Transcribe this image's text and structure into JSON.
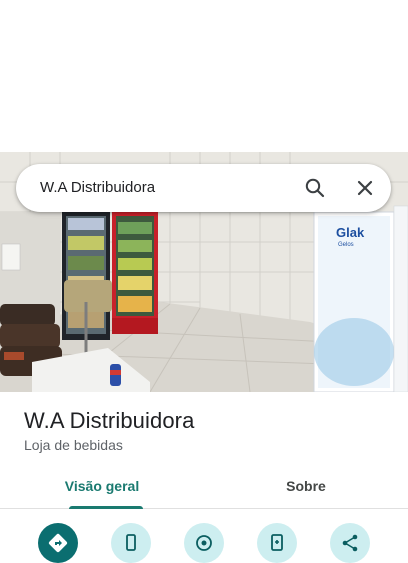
{
  "search": {
    "query": "W.A Distribuidora",
    "search_icon": "search-icon",
    "close_icon": "close-icon"
  },
  "photo": {
    "description_icon": "store-photo",
    "banner_text": "Glak",
    "banner_subtext": "Gelos"
  },
  "place": {
    "name": "W.A Distribuidora",
    "category": "Loja de bebidas"
  },
  "tabs": [
    {
      "label": "Visão geral",
      "active": true
    },
    {
      "label": "Sobre",
      "active": false
    }
  ],
  "actions": [
    {
      "icon": "directions-icon",
      "primary": true
    },
    {
      "icon": "phone-icon",
      "primary": false
    },
    {
      "icon": "nearby-icon",
      "primary": false
    },
    {
      "icon": "send-to-phone-icon",
      "primary": false
    },
    {
      "icon": "share-icon",
      "primary": false
    }
  ],
  "colors": {
    "accent": "#1a7a70",
    "primary_action": "#0b6e70",
    "secondary_action": "#cdeef0",
    "text_primary": "#202124",
    "text_secondary": "#5f6368"
  }
}
